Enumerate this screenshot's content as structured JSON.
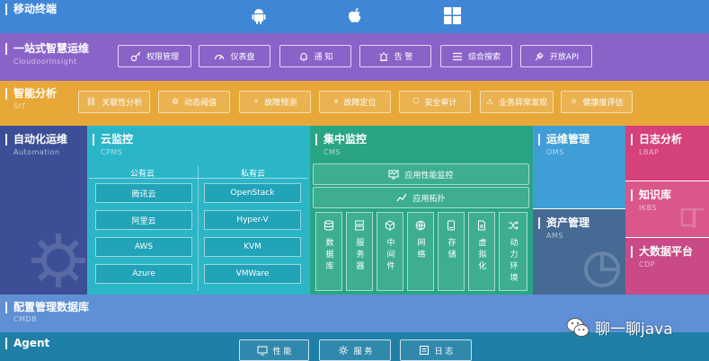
{
  "mobile": {
    "title": "移动终端"
  },
  "smart_ops": {
    "title": "一站式智慧运维",
    "subtitle": "CloudoorInsight",
    "items": [
      "权限管理",
      "仪表盘",
      "通  知",
      "告  警",
      "综合搜索",
      "开放API"
    ]
  },
  "sit": {
    "title": "智能分析",
    "subtitle": "SIT",
    "items": [
      "关联性分析",
      "动态阈值",
      "故障预测",
      "故障定位",
      "安全审计",
      "业务异常发现",
      "健康度评估"
    ]
  },
  "automation": {
    "title": "自动化运维",
    "subtitle": "Automation"
  },
  "cpms": {
    "title": "云监控",
    "subtitle": "CPMS",
    "public_label": "公有云",
    "private_label": "私有云",
    "public_items": [
      "腾讯云",
      "阿里云",
      "AWS",
      "Azure"
    ],
    "private_items": [
      "OpenStack",
      "Hyper-V",
      "KVM",
      "VMWare"
    ]
  },
  "cms": {
    "title": "集中监控",
    "subtitle": "CMS",
    "app_perf": "应用性能监控",
    "app_topo": "应用拓扑",
    "columns": [
      "数据库",
      "服务器",
      "中间件",
      "网络",
      "存储",
      "虚拟化",
      "动力环境"
    ]
  },
  "oms": {
    "title": "运维管理",
    "subtitle": "OMS"
  },
  "ams": {
    "title": "资产管理",
    "subtitle": "AMS"
  },
  "lbap": {
    "title": "日志分析",
    "subtitle": "LBAP"
  },
  "ikbs": {
    "title": "知识库",
    "subtitle": "IKBS"
  },
  "cdp": {
    "title": "大数据平台",
    "subtitle": "CDP"
  },
  "cmdb": {
    "title": "配置管理数据库",
    "subtitle": "CMDB"
  },
  "agent": {
    "title": "Agent",
    "items": [
      "性  能",
      "服  务",
      "日  志"
    ]
  },
  "watermark": {
    "text": "聊一聊java"
  },
  "colors": {
    "mobile": "#3f86d6",
    "smart_ops": "#8a63c9",
    "sit": "#e8a838",
    "automation": "#3c4f96",
    "cpms": "#2bb6c8",
    "cms": "#29a585",
    "oms": "#3f9ed6",
    "ams": "#456a94",
    "lbap": "#d5417a",
    "ikbs": "#d9578a",
    "cdp": "#c94a86",
    "cmdb": "#5f8fd4",
    "agent": "#1f7fa6"
  }
}
